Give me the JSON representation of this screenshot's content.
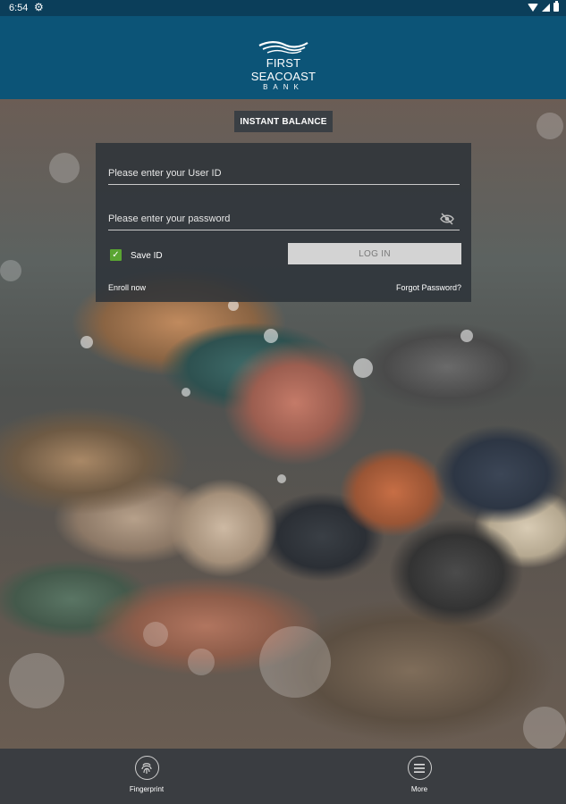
{
  "status_bar": {
    "time": "6:54"
  },
  "header": {
    "logo_line1": "FIRST SEACOAST",
    "logo_line2": "BANK"
  },
  "instant_balance_label": "INSTANT BALANCE",
  "login": {
    "user_id_placeholder": "Please enter your User ID",
    "password_placeholder": "Please enter your password",
    "save_id_label": "Save ID",
    "save_id_checked": true,
    "login_button_label": "LOG IN",
    "enroll_label": "Enroll now",
    "forgot_label": "Forgot Password?"
  },
  "bottom_nav": {
    "items": [
      {
        "label": "Fingerprint",
        "icon": "fingerprint-icon"
      },
      {
        "label": "More",
        "icon": "menu-icon"
      }
    ]
  },
  "colors": {
    "header_bg": "#0c5477",
    "status_bg": "#0b3e5a",
    "checkbox": "#5aa532",
    "panel_bg": "#2d3238",
    "bottom_bar": "#3a3d41"
  }
}
